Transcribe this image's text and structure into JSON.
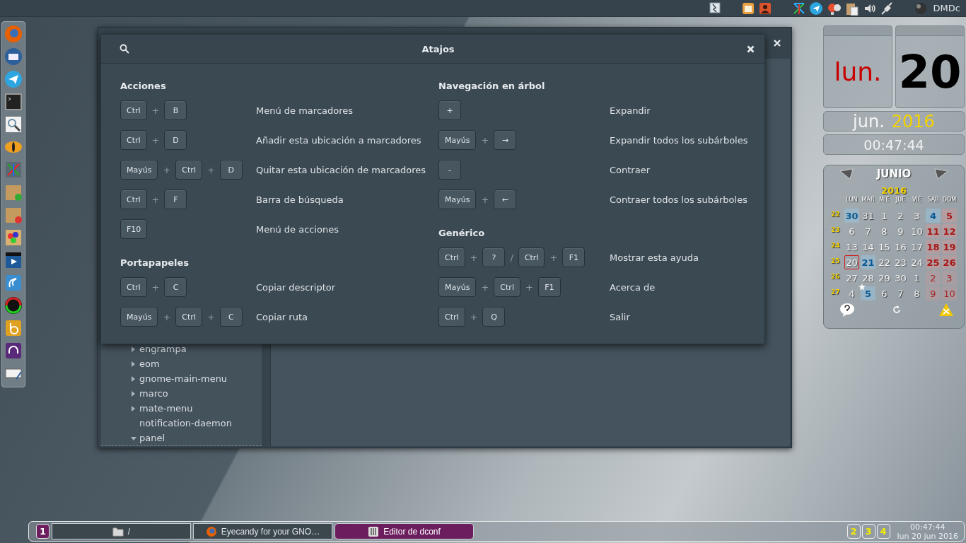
{
  "top_panel": {
    "user": "DMDc"
  },
  "background_window": {
    "tree": [
      {
        "label": "engrampa",
        "kind": "branch",
        "expanded": false
      },
      {
        "label": "eom",
        "kind": "branch",
        "expanded": false
      },
      {
        "label": "gnome-main-menu",
        "kind": "branch",
        "expanded": false
      },
      {
        "label": "marco",
        "kind": "branch",
        "expanded": false
      },
      {
        "label": "mate-menu",
        "kind": "branch",
        "expanded": false
      },
      {
        "label": "notification-daemon",
        "kind": "leaf"
      },
      {
        "label": "panel",
        "kind": "branch",
        "expanded": true
      }
    ]
  },
  "dialog": {
    "title": "Atajos",
    "columns": [
      {
        "sections": [
          {
            "title": "Acciones",
            "shortcuts": [
              {
                "keys": [
                  "Ctrl",
                  "+",
                  "B"
                ],
                "label": "Menú de marcadores"
              },
              {
                "keys": [
                  "Ctrl",
                  "+",
                  "D"
                ],
                "label": "Añadir esta ubicación a marcadores"
              },
              {
                "keys": [
                  "Mayús",
                  "+",
                  "Ctrl",
                  "+",
                  "D"
                ],
                "label": "Quitar esta ubicación de marcadores"
              },
              {
                "keys": [
                  "Ctrl",
                  "+",
                  "F"
                ],
                "label": "Barra de búsqueda"
              },
              {
                "keys": [
                  "F10"
                ],
                "label": "Menú de acciones"
              }
            ]
          },
          {
            "title": "Portapapeles",
            "shortcuts": [
              {
                "keys": [
                  "Ctrl",
                  "+",
                  "C"
                ],
                "label": "Copiar descriptor"
              },
              {
                "keys": [
                  "Mayús",
                  "+",
                  "Ctrl",
                  "+",
                  "C"
                ],
                "label": "Copiar ruta"
              }
            ]
          }
        ]
      },
      {
        "sections": [
          {
            "title": "Navegación en árbol",
            "shortcuts": [
              {
                "keys": [
                  "+"
                ],
                "label": "Expandir"
              },
              {
                "keys": [
                  "Mayús",
                  "+",
                  "→"
                ],
                "label": "Expandir todos los subárboles"
              },
              {
                "keys": [
                  "-"
                ],
                "label": "Contraer"
              },
              {
                "keys": [
                  "Mayús",
                  "+",
                  "←"
                ],
                "label": "Contraer todos los subárboles"
              }
            ]
          },
          {
            "title": "Genérico",
            "shortcuts": [
              {
                "keys": [
                  "Ctrl",
                  "+",
                  "?",
                  "/",
                  "Ctrl",
                  "+",
                  "F1"
                ],
                "label": "Mostrar esta ayuda"
              },
              {
                "keys": [
                  "Mayús",
                  "+",
                  "Ctrl",
                  "+",
                  "F1"
                ],
                "label": "Acerca de"
              },
              {
                "keys": [
                  "Ctrl",
                  "+",
                  "Q"
                ],
                "label": "Salir"
              }
            ]
          }
        ]
      }
    ]
  },
  "clock_widget": {
    "weekday": "lun.",
    "day": "20",
    "month": "jun.",
    "year": "2016",
    "time": "00:47:44"
  },
  "calendar_widget": {
    "month": "JUNIO",
    "year": "2016",
    "headers": [
      "LUN",
      "MAR",
      "MIE",
      "JUE",
      "VIE",
      "SAB",
      "DOM"
    ],
    "weeks": [
      {
        "week": "22",
        "days": [
          {
            "d": "30",
            "kind": "event"
          },
          {
            "d": "31",
            "kind": "dim"
          },
          {
            "d": "1",
            "kind": "plain"
          },
          {
            "d": "2",
            "kind": "plain"
          },
          {
            "d": "3",
            "kind": "plain"
          },
          {
            "d": "4",
            "kind": "event"
          },
          {
            "d": "5",
            "kind": "weekend"
          }
        ]
      },
      {
        "week": "23",
        "days": [
          {
            "d": "6",
            "kind": "plain"
          },
          {
            "d": "7",
            "kind": "plain"
          },
          {
            "d": "8",
            "kind": "plain"
          },
          {
            "d": "9",
            "kind": "plain"
          },
          {
            "d": "10",
            "kind": "plain"
          },
          {
            "d": "11",
            "kind": "weekend"
          },
          {
            "d": "12",
            "kind": "weekend"
          }
        ]
      },
      {
        "week": "24",
        "days": [
          {
            "d": "13",
            "kind": "plain"
          },
          {
            "d": "14",
            "kind": "plain"
          },
          {
            "d": "15",
            "kind": "plain"
          },
          {
            "d": "16",
            "kind": "plain"
          },
          {
            "d": "17",
            "kind": "plain"
          },
          {
            "d": "18",
            "kind": "weekend"
          },
          {
            "d": "19",
            "kind": "weekend"
          }
        ]
      },
      {
        "week": "25",
        "days": [
          {
            "d": "20",
            "kind": "today"
          },
          {
            "d": "21",
            "kind": "event"
          },
          {
            "d": "22",
            "kind": "plain"
          },
          {
            "d": "23",
            "kind": "plain"
          },
          {
            "d": "24",
            "kind": "plain"
          },
          {
            "d": "25",
            "kind": "weekend"
          },
          {
            "d": "26",
            "kind": "weekend"
          }
        ]
      },
      {
        "week": "26",
        "days": [
          {
            "d": "27",
            "kind": "plain"
          },
          {
            "d": "28",
            "kind": "plain"
          },
          {
            "d": "29",
            "kind": "plain"
          },
          {
            "d": "30",
            "kind": "plain"
          },
          {
            "d": "1",
            "kind": "dim"
          },
          {
            "d": "2",
            "kind": "weekend-dim"
          },
          {
            "d": "3",
            "kind": "weekend-dim"
          }
        ]
      },
      {
        "week": "27",
        "days": [
          {
            "d": "4",
            "kind": "dim"
          },
          {
            "d": "5",
            "kind": "event-star"
          },
          {
            "d": "6",
            "kind": "dim"
          },
          {
            "d": "7",
            "kind": "dim"
          },
          {
            "d": "8",
            "kind": "dim"
          },
          {
            "d": "9",
            "kind": "weekend-dim"
          },
          {
            "d": "10",
            "kind": "weekend-dim"
          }
        ]
      }
    ]
  },
  "bottom_panel": {
    "workspaces_left": [
      {
        "label": "1",
        "selected": true
      }
    ],
    "tasks": [
      {
        "title": "/",
        "selected": false
      },
      {
        "title": "Eyecandy for your GNO…",
        "selected": false
      },
      {
        "title": "Editor de dconf",
        "selected": true
      }
    ],
    "workspaces_right": [
      {
        "label": "2",
        "selected": false
      },
      {
        "label": "3",
        "selected": false
      },
      {
        "label": "4",
        "selected": false
      }
    ],
    "time": "00:47:44",
    "date": "lun 20 jun 2016"
  }
}
